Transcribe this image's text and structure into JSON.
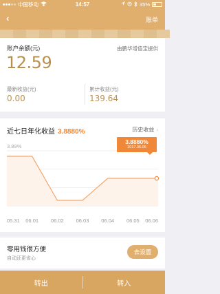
{
  "status_bar": {
    "carrier": "中国移动",
    "time": "14:57",
    "battery": "35%"
  },
  "nav": {
    "back_icon": "‹",
    "right_label": "账单"
  },
  "balance": {
    "title": "账户余额(元)",
    "provider": "由鹏华增值宝提供",
    "value": "12.59",
    "latest_label": "最新收益(元)",
    "latest_value": "0.00",
    "total_label": "累计收益(元)",
    "total_value": "139.64"
  },
  "chart_section": {
    "title": "近七日年化收益",
    "rate": "3.8880%",
    "history_label": "历史收益",
    "tooltip_value": "3.8880%",
    "tooltip_date": "2017.06.06"
  },
  "chart_data": {
    "type": "line",
    "x": [
      "05.31",
      "06.01",
      "06.02",
      "06.03",
      "06.04",
      "06.05",
      "06.06"
    ],
    "y_tick_labels": [
      "3.89%",
      "3.89%",
      "3.89%",
      "3.89%"
    ],
    "series": [
      {
        "values": [
          3.89,
          3.89,
          3.886,
          3.886,
          3.888,
          3.888,
          3.888
        ]
      }
    ],
    "ylim": [
      3.8855,
      3.8905
    ],
    "colors": {
      "line": "#f3a66c",
      "fill": "#fdf3ea",
      "grid": "#e6e6e6"
    }
  },
  "promo": {
    "title": "零用钱很方便",
    "subtitle": "自动还更省心",
    "button": "去设置"
  },
  "bottom": {
    "transfer_out": "转出",
    "transfer_in": "转入"
  }
}
